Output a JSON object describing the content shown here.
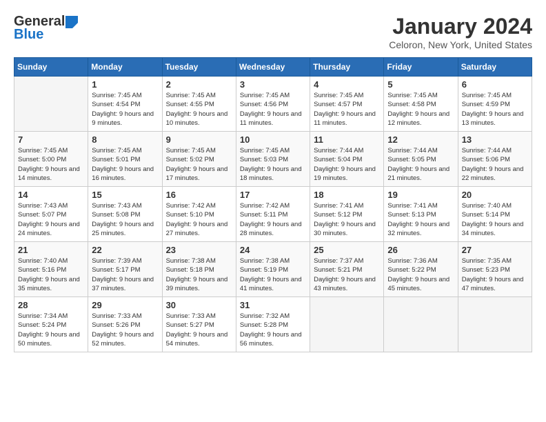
{
  "header": {
    "logo_general": "General",
    "logo_blue": "Blue",
    "month": "January 2024",
    "location": "Celoron, New York, United States"
  },
  "days_of_week": [
    "Sunday",
    "Monday",
    "Tuesday",
    "Wednesday",
    "Thursday",
    "Friday",
    "Saturday"
  ],
  "weeks": [
    [
      {
        "day": "",
        "sunrise": "",
        "sunset": "",
        "daylight": ""
      },
      {
        "day": "1",
        "sunrise": "Sunrise: 7:45 AM",
        "sunset": "Sunset: 4:54 PM",
        "daylight": "Daylight: 9 hours and 9 minutes."
      },
      {
        "day": "2",
        "sunrise": "Sunrise: 7:45 AM",
        "sunset": "Sunset: 4:55 PM",
        "daylight": "Daylight: 9 hours and 10 minutes."
      },
      {
        "day": "3",
        "sunrise": "Sunrise: 7:45 AM",
        "sunset": "Sunset: 4:56 PM",
        "daylight": "Daylight: 9 hours and 11 minutes."
      },
      {
        "day": "4",
        "sunrise": "Sunrise: 7:45 AM",
        "sunset": "Sunset: 4:57 PM",
        "daylight": "Daylight: 9 hours and 11 minutes."
      },
      {
        "day": "5",
        "sunrise": "Sunrise: 7:45 AM",
        "sunset": "Sunset: 4:58 PM",
        "daylight": "Daylight: 9 hours and 12 minutes."
      },
      {
        "day": "6",
        "sunrise": "Sunrise: 7:45 AM",
        "sunset": "Sunset: 4:59 PM",
        "daylight": "Daylight: 9 hours and 13 minutes."
      }
    ],
    [
      {
        "day": "7",
        "sunrise": "Sunrise: 7:45 AM",
        "sunset": "Sunset: 5:00 PM",
        "daylight": "Daylight: 9 hours and 14 minutes."
      },
      {
        "day": "8",
        "sunrise": "Sunrise: 7:45 AM",
        "sunset": "Sunset: 5:01 PM",
        "daylight": "Daylight: 9 hours and 16 minutes."
      },
      {
        "day": "9",
        "sunrise": "Sunrise: 7:45 AM",
        "sunset": "Sunset: 5:02 PM",
        "daylight": "Daylight: 9 hours and 17 minutes."
      },
      {
        "day": "10",
        "sunrise": "Sunrise: 7:45 AM",
        "sunset": "Sunset: 5:03 PM",
        "daylight": "Daylight: 9 hours and 18 minutes."
      },
      {
        "day": "11",
        "sunrise": "Sunrise: 7:44 AM",
        "sunset": "Sunset: 5:04 PM",
        "daylight": "Daylight: 9 hours and 19 minutes."
      },
      {
        "day": "12",
        "sunrise": "Sunrise: 7:44 AM",
        "sunset": "Sunset: 5:05 PM",
        "daylight": "Daylight: 9 hours and 21 minutes."
      },
      {
        "day": "13",
        "sunrise": "Sunrise: 7:44 AM",
        "sunset": "Sunset: 5:06 PM",
        "daylight": "Daylight: 9 hours and 22 minutes."
      }
    ],
    [
      {
        "day": "14",
        "sunrise": "Sunrise: 7:43 AM",
        "sunset": "Sunset: 5:07 PM",
        "daylight": "Daylight: 9 hours and 24 minutes."
      },
      {
        "day": "15",
        "sunrise": "Sunrise: 7:43 AM",
        "sunset": "Sunset: 5:08 PM",
        "daylight": "Daylight: 9 hours and 25 minutes."
      },
      {
        "day": "16",
        "sunrise": "Sunrise: 7:42 AM",
        "sunset": "Sunset: 5:10 PM",
        "daylight": "Daylight: 9 hours and 27 minutes."
      },
      {
        "day": "17",
        "sunrise": "Sunrise: 7:42 AM",
        "sunset": "Sunset: 5:11 PM",
        "daylight": "Daylight: 9 hours and 28 minutes."
      },
      {
        "day": "18",
        "sunrise": "Sunrise: 7:41 AM",
        "sunset": "Sunset: 5:12 PM",
        "daylight": "Daylight: 9 hours and 30 minutes."
      },
      {
        "day": "19",
        "sunrise": "Sunrise: 7:41 AM",
        "sunset": "Sunset: 5:13 PM",
        "daylight": "Daylight: 9 hours and 32 minutes."
      },
      {
        "day": "20",
        "sunrise": "Sunrise: 7:40 AM",
        "sunset": "Sunset: 5:14 PM",
        "daylight": "Daylight: 9 hours and 34 minutes."
      }
    ],
    [
      {
        "day": "21",
        "sunrise": "Sunrise: 7:40 AM",
        "sunset": "Sunset: 5:16 PM",
        "daylight": "Daylight: 9 hours and 35 minutes."
      },
      {
        "day": "22",
        "sunrise": "Sunrise: 7:39 AM",
        "sunset": "Sunset: 5:17 PM",
        "daylight": "Daylight: 9 hours and 37 minutes."
      },
      {
        "day": "23",
        "sunrise": "Sunrise: 7:38 AM",
        "sunset": "Sunset: 5:18 PM",
        "daylight": "Daylight: 9 hours and 39 minutes."
      },
      {
        "day": "24",
        "sunrise": "Sunrise: 7:38 AM",
        "sunset": "Sunset: 5:19 PM",
        "daylight": "Daylight: 9 hours and 41 minutes."
      },
      {
        "day": "25",
        "sunrise": "Sunrise: 7:37 AM",
        "sunset": "Sunset: 5:21 PM",
        "daylight": "Daylight: 9 hours and 43 minutes."
      },
      {
        "day": "26",
        "sunrise": "Sunrise: 7:36 AM",
        "sunset": "Sunset: 5:22 PM",
        "daylight": "Daylight: 9 hours and 45 minutes."
      },
      {
        "day": "27",
        "sunrise": "Sunrise: 7:35 AM",
        "sunset": "Sunset: 5:23 PM",
        "daylight": "Daylight: 9 hours and 47 minutes."
      }
    ],
    [
      {
        "day": "28",
        "sunrise": "Sunrise: 7:34 AM",
        "sunset": "Sunset: 5:24 PM",
        "daylight": "Daylight: 9 hours and 50 minutes."
      },
      {
        "day": "29",
        "sunrise": "Sunrise: 7:33 AM",
        "sunset": "Sunset: 5:26 PM",
        "daylight": "Daylight: 9 hours and 52 minutes."
      },
      {
        "day": "30",
        "sunrise": "Sunrise: 7:33 AM",
        "sunset": "Sunset: 5:27 PM",
        "daylight": "Daylight: 9 hours and 54 minutes."
      },
      {
        "day": "31",
        "sunrise": "Sunrise: 7:32 AM",
        "sunset": "Sunset: 5:28 PM",
        "daylight": "Daylight: 9 hours and 56 minutes."
      },
      {
        "day": "",
        "sunrise": "",
        "sunset": "",
        "daylight": ""
      },
      {
        "day": "",
        "sunrise": "",
        "sunset": "",
        "daylight": ""
      },
      {
        "day": "",
        "sunrise": "",
        "sunset": "",
        "daylight": ""
      }
    ]
  ]
}
